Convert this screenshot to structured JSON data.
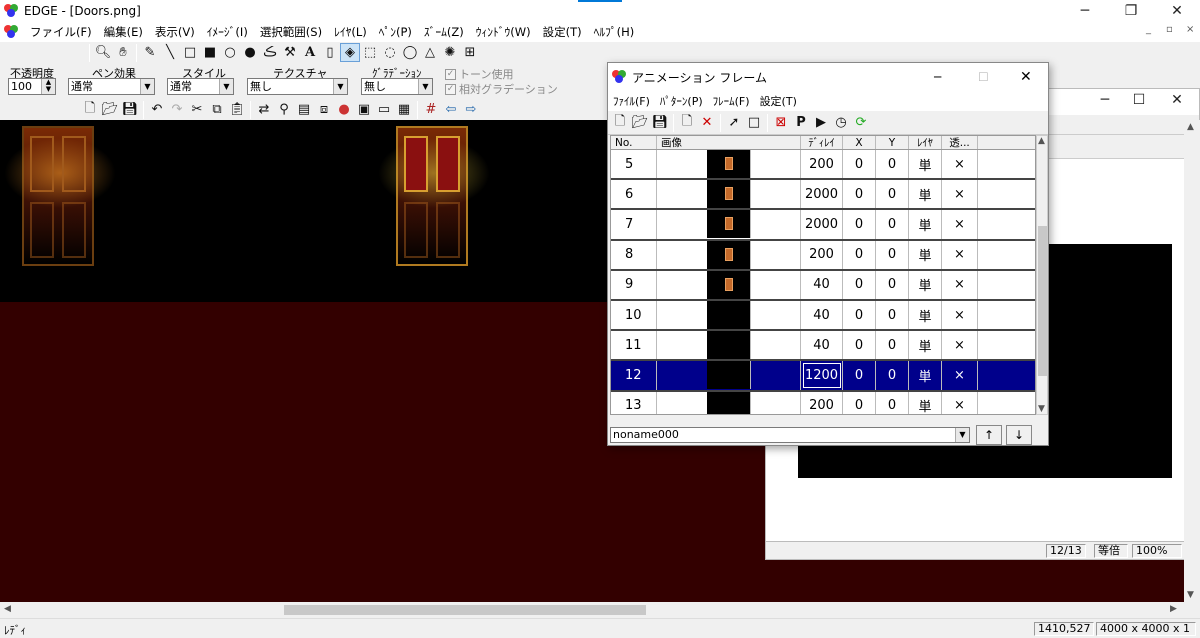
{
  "window": {
    "title": "EDGE - [Doors.png]"
  },
  "menubar": [
    "ファイル(F)",
    "編集(E)",
    "表示(V)",
    "ｲﾒｰｼﾞ(I)",
    "選択範囲(S)",
    "ﾚｲﾔ(L)",
    "ﾍﾟﾝ(P)",
    "ｽﾞｰﾑ(Z)",
    "ｳｨﾝﾄﾞｳ(W)",
    "設定(T)",
    "ﾍﾙﾌﾟ(H)"
  ],
  "options": {
    "opacity_label": "不透明度",
    "opacity_value": "100",
    "pen_effect_label": "ペン効果",
    "pen_effect_value": "通常",
    "style_label": "スタイル",
    "style_value": "通常",
    "texture_label": "テクスチャ",
    "texture_value": "無し",
    "gradation_label": "ｸﾞﾗﾃﾞｰｼｮﾝ",
    "gradation_value": "無し",
    "tone_use_label": "トーン使用",
    "relative_gradation_label": "相対グラデーション"
  },
  "anim": {
    "title": "アニメーション フレーム",
    "menu": [
      "ﾌｧｲﾙ(F)",
      "ﾊﾟﾀｰﾝ(P)",
      "ﾌﾚｰﾑ(F)",
      "設定(T)"
    ],
    "columns": {
      "no": "No.",
      "image": "画像",
      "delay": "ﾃﾞｨﾚｲ",
      "x": "X",
      "y": "Y",
      "layer": "ﾚｲﾔ",
      "transparent": "透..."
    },
    "rows": [
      {
        "no": "5",
        "delay": "200",
        "x": "0",
        "y": "0",
        "layer": "単",
        "trans": "×"
      },
      {
        "no": "6",
        "delay": "2000",
        "x": "0",
        "y": "0",
        "layer": "単",
        "trans": "×"
      },
      {
        "no": "7",
        "delay": "2000",
        "x": "0",
        "y": "0",
        "layer": "単",
        "trans": "×"
      },
      {
        "no": "8",
        "delay": "200",
        "x": "0",
        "y": "0",
        "layer": "単",
        "trans": "×"
      },
      {
        "no": "9",
        "delay": "40",
        "x": "0",
        "y": "0",
        "layer": "単",
        "trans": "×"
      },
      {
        "no": "10",
        "delay": "40",
        "x": "0",
        "y": "0",
        "layer": "単",
        "trans": "×"
      },
      {
        "no": "11",
        "delay": "40",
        "x": "0",
        "y": "0",
        "layer": "単",
        "trans": "×"
      },
      {
        "no": "12",
        "delay": "1200",
        "x": "0",
        "y": "0",
        "layer": "単",
        "trans": "×"
      },
      {
        "no": "13",
        "delay": "200",
        "x": "0",
        "y": "0",
        "layer": "単",
        "trans": "×"
      }
    ],
    "selected_row": "12",
    "pattern_name": "noname000",
    "up_label": "↑",
    "down_label": "↓"
  },
  "doc": {
    "frame_counter": "12/13",
    "zoom_mode": "等倍",
    "zoom_percent": "100%"
  },
  "status": {
    "ready": "ﾚﾃﾞｨ",
    "coords": "1410,527",
    "dimensions": "4000 x 4000 x 1"
  },
  "colors": {
    "canvas_bg": "#330000",
    "selection": "#00008b",
    "accent": "#0078d7"
  }
}
